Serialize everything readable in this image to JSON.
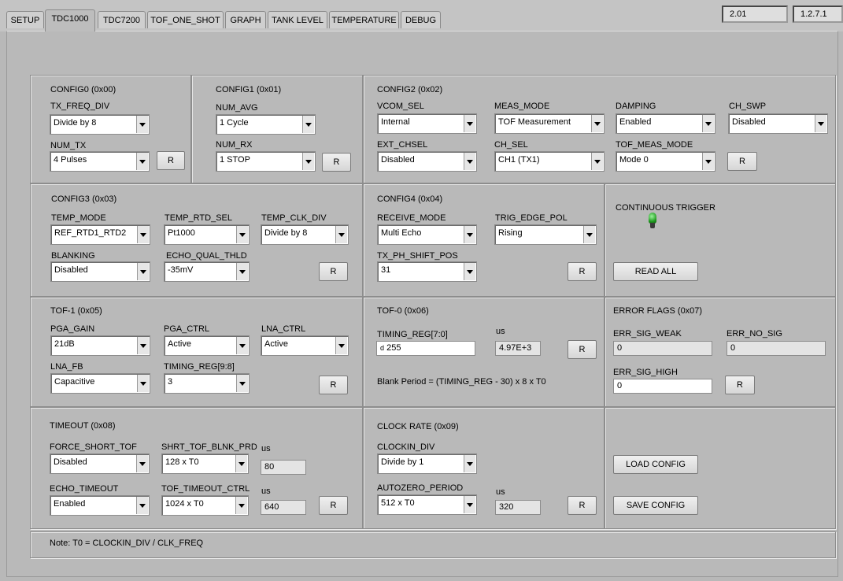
{
  "tabs": [
    "SETUP",
    "TDC1000",
    "TDC7200",
    "TOF_ONE_SHOT",
    "GRAPH",
    "TANK LEVEL",
    "TEMPERATURE",
    "DEBUG"
  ],
  "active_tab": "TDC1000",
  "versions": {
    "left": "2.01",
    "right": "1.2.7.1"
  },
  "config0": {
    "title": "CONFIG0 (0x00)",
    "tx_freq_div": {
      "label": "TX_FREQ_DIV",
      "value": "Divide by 8"
    },
    "num_tx": {
      "label": "NUM_TX",
      "value": "4 Pulses"
    },
    "r": "R"
  },
  "config1": {
    "title": "CONFIG1 (0x01)",
    "num_avg": {
      "label": "NUM_AVG",
      "value": "1 Cycle"
    },
    "num_rx": {
      "label": "NUM_RX",
      "value": "1 STOP"
    },
    "r": "R"
  },
  "config2": {
    "title": "CONFIG2 (0x02)",
    "vcom_sel": {
      "label": "VCOM_SEL",
      "value": "Internal"
    },
    "meas_mode": {
      "label": "MEAS_MODE",
      "value": "TOF Measurement"
    },
    "damping": {
      "label": "DAMPING",
      "value": "Enabled"
    },
    "ch_swp": {
      "label": "CH_SWP",
      "value": "Disabled"
    },
    "ext_chsel": {
      "label": "EXT_CHSEL",
      "value": "Disabled"
    },
    "ch_sel": {
      "label": "CH_SEL",
      "value": "CH1 (TX1)"
    },
    "tof_meas_mode": {
      "label": "TOF_MEAS_MODE",
      "value": "Mode 0"
    },
    "r": "R"
  },
  "config3": {
    "title": "CONFIG3 (0x03)",
    "temp_mode": {
      "label": "TEMP_MODE",
      "value": "REF_RTD1_RTD2"
    },
    "temp_rtd_sel": {
      "label": "TEMP_RTD_SEL",
      "value": "Pt1000"
    },
    "temp_clk_div": {
      "label": "TEMP_CLK_DIV",
      "value": "Divide by 8"
    },
    "blanking": {
      "label": "BLANKING",
      "value": "Disabled"
    },
    "echo_qual_thld": {
      "label": "ECHO_QUAL_THLD",
      "value": "-35mV"
    },
    "r": "R"
  },
  "config4": {
    "title": "CONFIG4 (0x04)",
    "receive_mode": {
      "label": "RECEIVE_MODE",
      "value": "Multi Echo"
    },
    "trig_edge_pol": {
      "label": "TRIG_EDGE_POL",
      "value": "Rising"
    },
    "tx_ph_shift_pos": {
      "label": "TX_PH_SHIFT_POS",
      "value": "31"
    },
    "r": "R"
  },
  "trigger": {
    "label": "CONTINUOUS TRIGGER",
    "read_all": "READ ALL",
    "led_color": "#1f9a1f"
  },
  "tof1": {
    "title": "TOF-1 (0x05)",
    "pga_gain": {
      "label": "PGA_GAIN",
      "value": "21dB"
    },
    "pga_ctrl": {
      "label": "PGA_CTRL",
      "value": "Active"
    },
    "lna_ctrl": {
      "label": "LNA_CTRL",
      "value": "Active"
    },
    "lna_fb": {
      "label": "LNA_FB",
      "value": "Capacitive"
    },
    "timing_reg_hi": {
      "label": "TIMING_REG[9:8]",
      "value": "3"
    },
    "r": "R"
  },
  "tof0": {
    "title": "TOF-0 (0x06)",
    "timing_reg_lo": {
      "label": "TIMING_REG[7:0]",
      "radix": "d",
      "value": "255"
    },
    "us": {
      "label": "us",
      "value": "4.97E+3"
    },
    "formula": "Blank Period = (TIMING_REG - 30) x 8 x T0",
    "r": "R"
  },
  "error_flags": {
    "title": "ERROR FLAGS (0x07)",
    "err_sig_weak": {
      "label": "ERR_SIG_WEAK",
      "value": "0"
    },
    "err_no_sig": {
      "label": "ERR_NO_SIG",
      "value": "0"
    },
    "err_sig_high": {
      "label": "ERR_SIG_HIGH",
      "value": "0"
    },
    "r": "R"
  },
  "timeout": {
    "title": "TIMEOUT (0x08)",
    "force_short_tof": {
      "label": "FORCE_SHORT_TOF",
      "value": "Disabled"
    },
    "shrt_tof_blnk_prd": {
      "label": "SHRT_TOF_BLNK_PRD",
      "value": "128 x T0"
    },
    "us1": {
      "label": "us",
      "value": "80"
    },
    "echo_timeout": {
      "label": "ECHO_TIMEOUT",
      "value": "Enabled"
    },
    "tof_timeout_ctrl": {
      "label": "TOF_TIMEOUT_CTRL",
      "value": "1024 x T0"
    },
    "us2": {
      "label": "us",
      "value": "640"
    },
    "r": "R"
  },
  "clock_rate": {
    "title": "CLOCK RATE (0x09)",
    "clockin_div": {
      "label": "CLOCKIN_DIV",
      "value": "Divide by 1"
    },
    "autozero_period": {
      "label": "AUTOZERO_PERIOD",
      "value": "512 x T0"
    },
    "us": {
      "label": "us",
      "value": "320"
    },
    "r": "R"
  },
  "config_buttons": {
    "load": "LOAD CONFIG",
    "save": "SAVE CONFIG"
  },
  "note": "Note: T0 = CLOCKIN_DIV / CLK_FREQ"
}
